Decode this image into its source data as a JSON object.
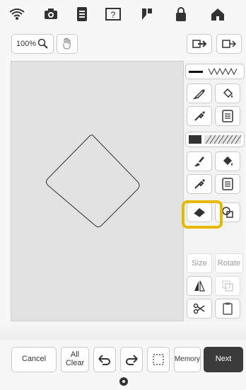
{
  "status_bar": {
    "icons": [
      "wifi-icon",
      "camera-icon",
      "document-icon",
      "help-icon",
      "thread-icon",
      "lock-icon",
      "home-icon"
    ]
  },
  "toolbar": {
    "zoom_label": "100%",
    "zoom_icon": "magnifier-icon",
    "hand_icon": "hand-icon",
    "import_icon": "import-icon",
    "export_icon": "export-icon"
  },
  "right_panel": {
    "line_sample_label": "",
    "size_label": "Size",
    "rotate_label": "Rotate"
  },
  "bottom_bar": {
    "cancel_label": "Cancel",
    "all_clear_label_line1": "All",
    "all_clear_label_line2": "Clear",
    "memory_label": "Memory",
    "next_label": "Next"
  },
  "colors": {
    "highlight": "#e6b800",
    "next_bg": "#3b3b3b"
  }
}
